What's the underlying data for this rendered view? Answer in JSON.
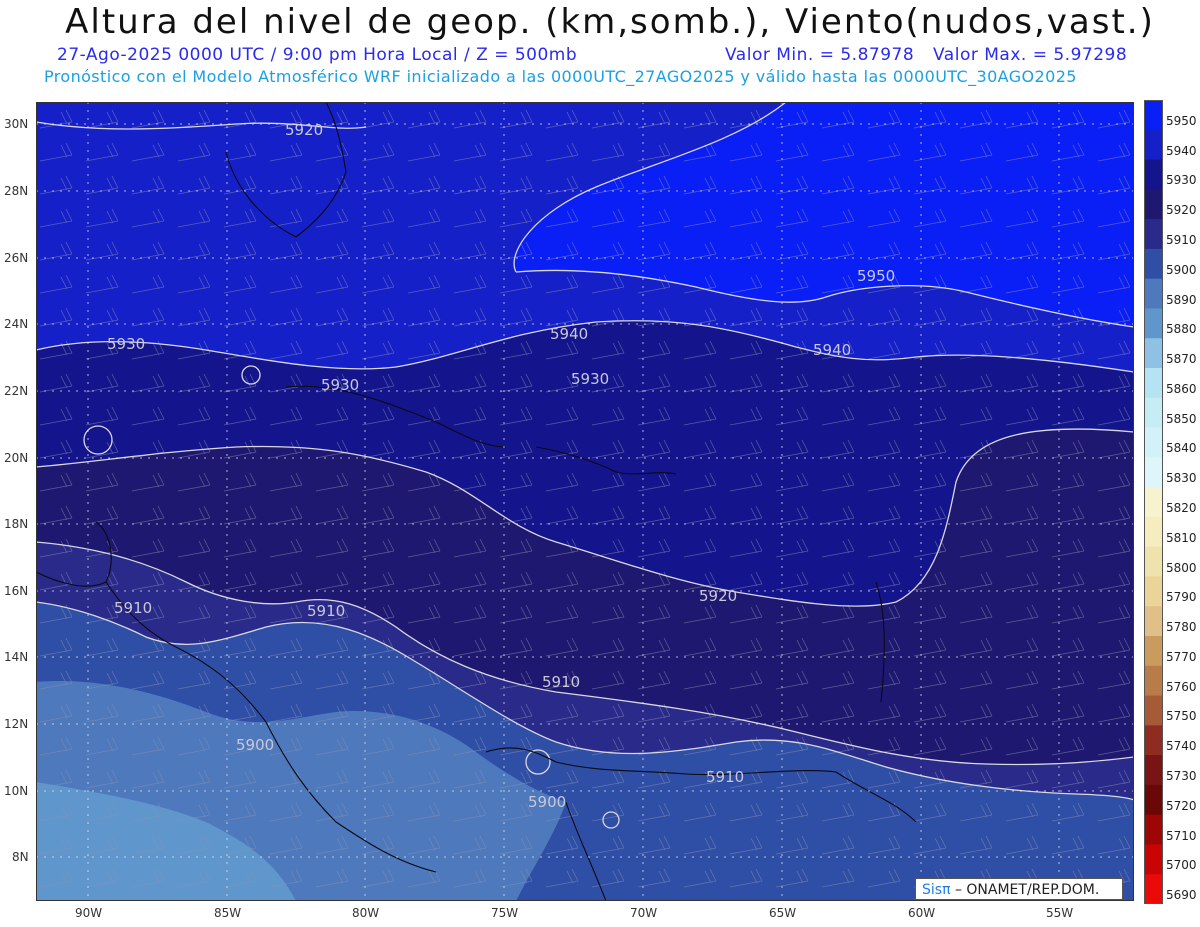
{
  "title": "Altura del nivel de geop. (km,somb.), Viento(nudos,vast.)",
  "subtitle_date": "27-Ago-2025  0000 UTC / 9:00 pm Hora Local / Z = 500mb",
  "subtitle_min": "Valor Min. = 5.87978",
  "subtitle_max": "Valor Max. = 5.97298",
  "subtitle_model": "Pronóstico con el Modelo Atmosférico WRF inicializado a las 0000UTC_27AGO2025 y válido hasta las  0000UTC_30AGO2025",
  "lat_labels": [
    "30N",
    "28N",
    "26N",
    "24N",
    "22N",
    "20N",
    "18N",
    "16N",
    "14N",
    "12N",
    "10N",
    "8N"
  ],
  "lon_labels": [
    "90W",
    "85W",
    "80W",
    "75W",
    "70W",
    "65W",
    "60W",
    "55W"
  ],
  "colorbar": {
    "levels": [
      "5950",
      "5940",
      "5930",
      "5920",
      "5910",
      "5900",
      "5890",
      "5880",
      "5870",
      "5860",
      "5850",
      "5840",
      "5830",
      "5820",
      "5810",
      "5800",
      "5790",
      "5780",
      "5770",
      "5760",
      "5750",
      "5740",
      "5730",
      "5720",
      "5710",
      "5700",
      "5690"
    ],
    "colors": [
      "#0a1ff5",
      "#1520c8",
      "#14158c",
      "#1f1870",
      "#2a2a8a",
      "#2f4fa6",
      "#4e79bd",
      "#5f96cc",
      "#8ec1e3",
      "#b5e3f3",
      "#c6ecf6",
      "#d3f1f8",
      "#def6fa",
      "#f8f3cf",
      "#f5ecc0",
      "#f0e2ac",
      "#ead49a",
      "#e0c088",
      "#c99b5e",
      "#b87c4b",
      "#a65a38",
      "#8f2c22",
      "#7a1414",
      "#6a0808",
      "#9e0505",
      "#c80404",
      "#ea0a0a"
    ]
  },
  "contour_labels": [
    "5920",
    "5950",
    "5940",
    "5940",
    "5930",
    "5930",
    "5930",
    "5920",
    "5910",
    "5910",
    "5910",
    "5900",
    "5910",
    "5900"
  ],
  "credit": {
    "brand": "Sisπ",
    "text": "– ONAMET/REP.DOM."
  },
  "colors": {
    "bg_5950": "#0a1ff5",
    "bg_5940": "#1520c8",
    "bg_5930": "#14158c",
    "bg_5920": "#1f1870",
    "bg_5910": "#2a2a8a",
    "bg_5900": "#2f4fa6",
    "bg_5890": "#4e79bd",
    "title_blue": "#2a2af0",
    "model_blue": "#1aa0e6"
  }
}
